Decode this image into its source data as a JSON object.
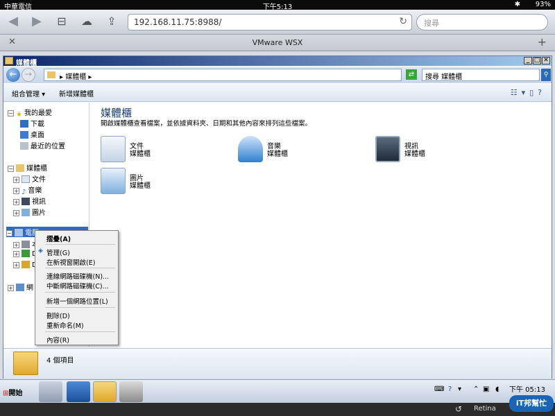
{
  "status_bar": {
    "carrier": "中華電信",
    "time": "下午5:13",
    "battery": "93%"
  },
  "browser": {
    "url": "192.168.11.75:8988/",
    "search_placeholder": "搜尋",
    "tab_title": "VMware WSX"
  },
  "window": {
    "title": "媒體櫃",
    "address_path": "▸ 媒體櫃 ▸",
    "search_value": "搜尋 媒體櫃",
    "toolbar": {
      "organize": "組合管理 ▾",
      "new_library": "新增媒體櫃"
    },
    "nav": {
      "favorites": "我的最愛",
      "favorites_items": [
        "下載",
        "桌面",
        "最近的位置"
      ],
      "libraries": "媒體櫃",
      "library_items": [
        "文件",
        "音樂",
        "視訊",
        "圖片"
      ],
      "computer": "電腦",
      "computer_items": [
        "本",
        "D",
        "D"
      ],
      "network": "網"
    },
    "content": {
      "heading": "媒體櫃",
      "description": "開啟媒體櫃查看檔案，並依據資料夾、日期和其他內容來排列這些檔案。",
      "libraries": [
        {
          "name": "文件",
          "sub": "媒體櫃"
        },
        {
          "name": "音樂",
          "sub": "媒體櫃"
        },
        {
          "name": "視訊",
          "sub": "媒體櫃"
        },
        {
          "name": "圖片",
          "sub": "媒體櫃"
        }
      ]
    },
    "details": {
      "item_count": "4 個項目"
    }
  },
  "context_menu": {
    "items": [
      "摺疊(A)",
      "管理(G)",
      "在新視窗開啟(E)",
      "連線網路磁碟機(N)...",
      "中斷網路磁碟機(C)...",
      "新增一個網路位置(L)",
      "刪除(D)",
      "重新命名(M)",
      "內容(R)"
    ]
  },
  "taskbar": {
    "start": "開始",
    "clock": "下午 05:13"
  },
  "ipad_bar": {
    "retina": "Retina"
  },
  "watermark": "iT邦幫忙"
}
